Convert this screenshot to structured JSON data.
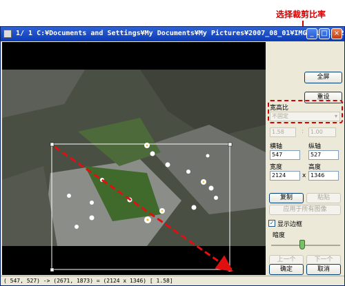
{
  "annotation": {
    "text": "选择裁剪比率"
  },
  "window": {
    "title": "1/ 1  C:¥Documents and Settings¥My Documents¥My Pictures¥2007_08_01¥IMG_0101.CR2",
    "buttons": {
      "minimize": "_",
      "maximize": "□",
      "close": "×"
    }
  },
  "panel": {
    "fullscreen_label": "全屏",
    "reset_label": "重设",
    "aspect_label": "宽高比",
    "aspect_value": "不固定",
    "ratio_w": "1.58",
    "ratio_sep": ":",
    "ratio_h": "1.00",
    "x_label": "横轴",
    "y_label": "纵轴",
    "x_value": "547",
    "y_value": "527",
    "width_label": "宽度",
    "height_label": "高度",
    "width_value": "2124",
    "size_sep": "x",
    "height_value": "1346",
    "copy_label": "复制",
    "paste_label": "粘贴",
    "apply_all_label": "应用于所有图像",
    "show_border_label": "显示边框",
    "brightness_label": "暗度",
    "brightness_level": 0.45,
    "prev_label": "上一个",
    "next_label": "下一个",
    "ok_label": "确定",
    "cancel_label": "取消"
  },
  "status": {
    "text": "( 547,  527) -> (2671, 1873) = (2124 x 1346) [ 1.58]"
  },
  "colors": {
    "accent_red": "#d40000",
    "title_blue": "#0b3bb6",
    "crop_border": "#ffffff"
  }
}
